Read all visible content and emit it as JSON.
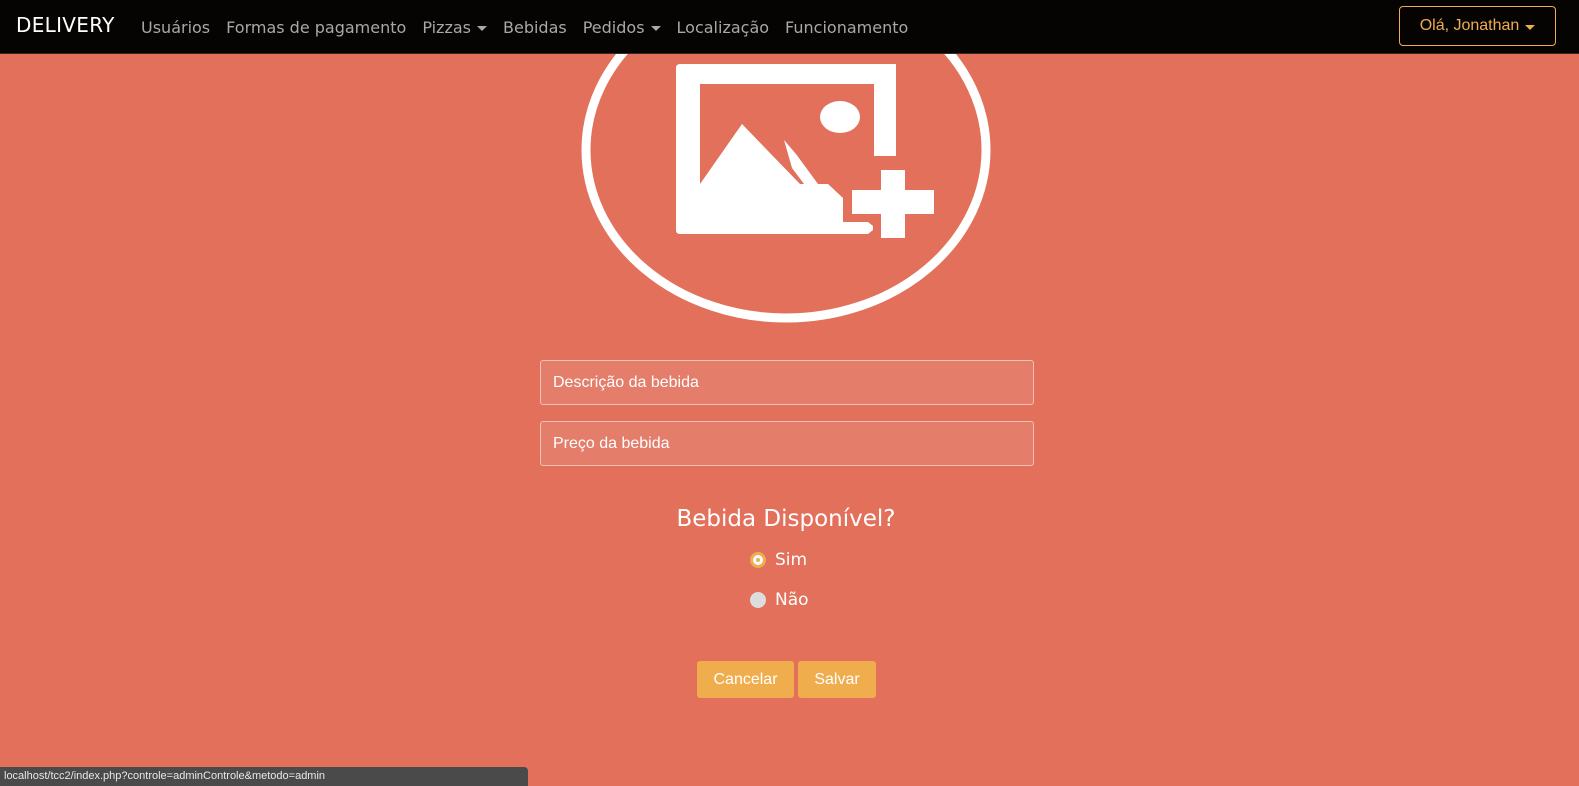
{
  "navbar": {
    "brand": "DELIVERY",
    "items": [
      {
        "label": "Usuários",
        "dropdown": false
      },
      {
        "label": "Formas de pagamento",
        "dropdown": false
      },
      {
        "label": "Pizzas",
        "dropdown": true
      },
      {
        "label": "Bebidas",
        "dropdown": false
      },
      {
        "label": "Pedidos",
        "dropdown": true
      },
      {
        "label": "Localização",
        "dropdown": false
      },
      {
        "label": "Funcionamento",
        "dropdown": false
      }
    ],
    "user_greeting": "Olá, Jonathan"
  },
  "upload": {
    "icon": "add-image-icon"
  },
  "form": {
    "description_placeholder": "Descrição da bebida",
    "description_value": "",
    "price_placeholder": "Preço da bebida",
    "price_value": "",
    "availability_question": "Bebida Disponível?",
    "options": [
      {
        "label": "Sim",
        "checked": true
      },
      {
        "label": "Não",
        "checked": false
      }
    ],
    "cancel_label": "Cancelar",
    "save_label": "Salvar"
  },
  "statusbar": {
    "url": "localhost/tcc2/index.php?controle=adminControle&metodo=admin"
  },
  "colors": {
    "background": "#e2705a",
    "navbar": "#050403",
    "accent": "#f0ad4e",
    "nav_text": "#a8a8a8"
  }
}
